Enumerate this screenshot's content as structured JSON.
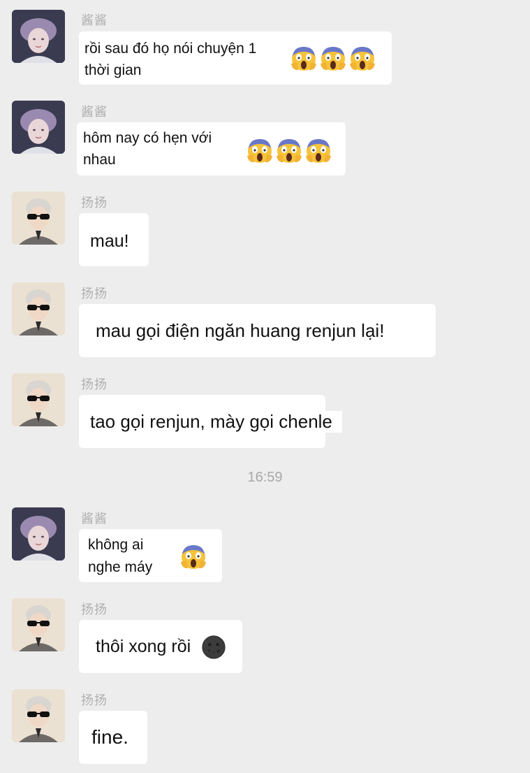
{
  "messages": [
    {
      "sender": "酱酱",
      "lines": [
        "rồi sau đó họ nói chuyện 1",
        "thời gian"
      ],
      "emoji": [
        "screaming-face-emoji",
        "screaming-face-emoji",
        "screaming-face-emoji"
      ]
    },
    {
      "sender": "酱酱",
      "lines": [
        "hôm nay có hẹn với",
        "nhau"
      ],
      "emoji": [
        "screaming-face-emoji",
        "screaming-face-emoji",
        "screaming-face-emoji"
      ]
    },
    {
      "sender": "扬扬",
      "lines": [
        "mau!"
      ]
    },
    {
      "sender": "扬扬",
      "lines": [
        "mau gọi điện ngăn huang renjun lại!"
      ]
    },
    {
      "sender": "扬扬",
      "lines": [
        "tao gọi renjun, mày gọi chenle"
      ]
    },
    {
      "sender": "酱酱",
      "lines": [
        "không ai",
        "nghe máy"
      ],
      "emoji": [
        "screaming-face-emoji"
      ]
    },
    {
      "sender": "扬扬",
      "lines": [
        "thôi xong rồi"
      ],
      "emoji": [
        "new-moon-face-emoji"
      ]
    },
    {
      "sender": "扬扬",
      "lines": [
        "fine."
      ]
    }
  ],
  "timestamp": "16:59"
}
